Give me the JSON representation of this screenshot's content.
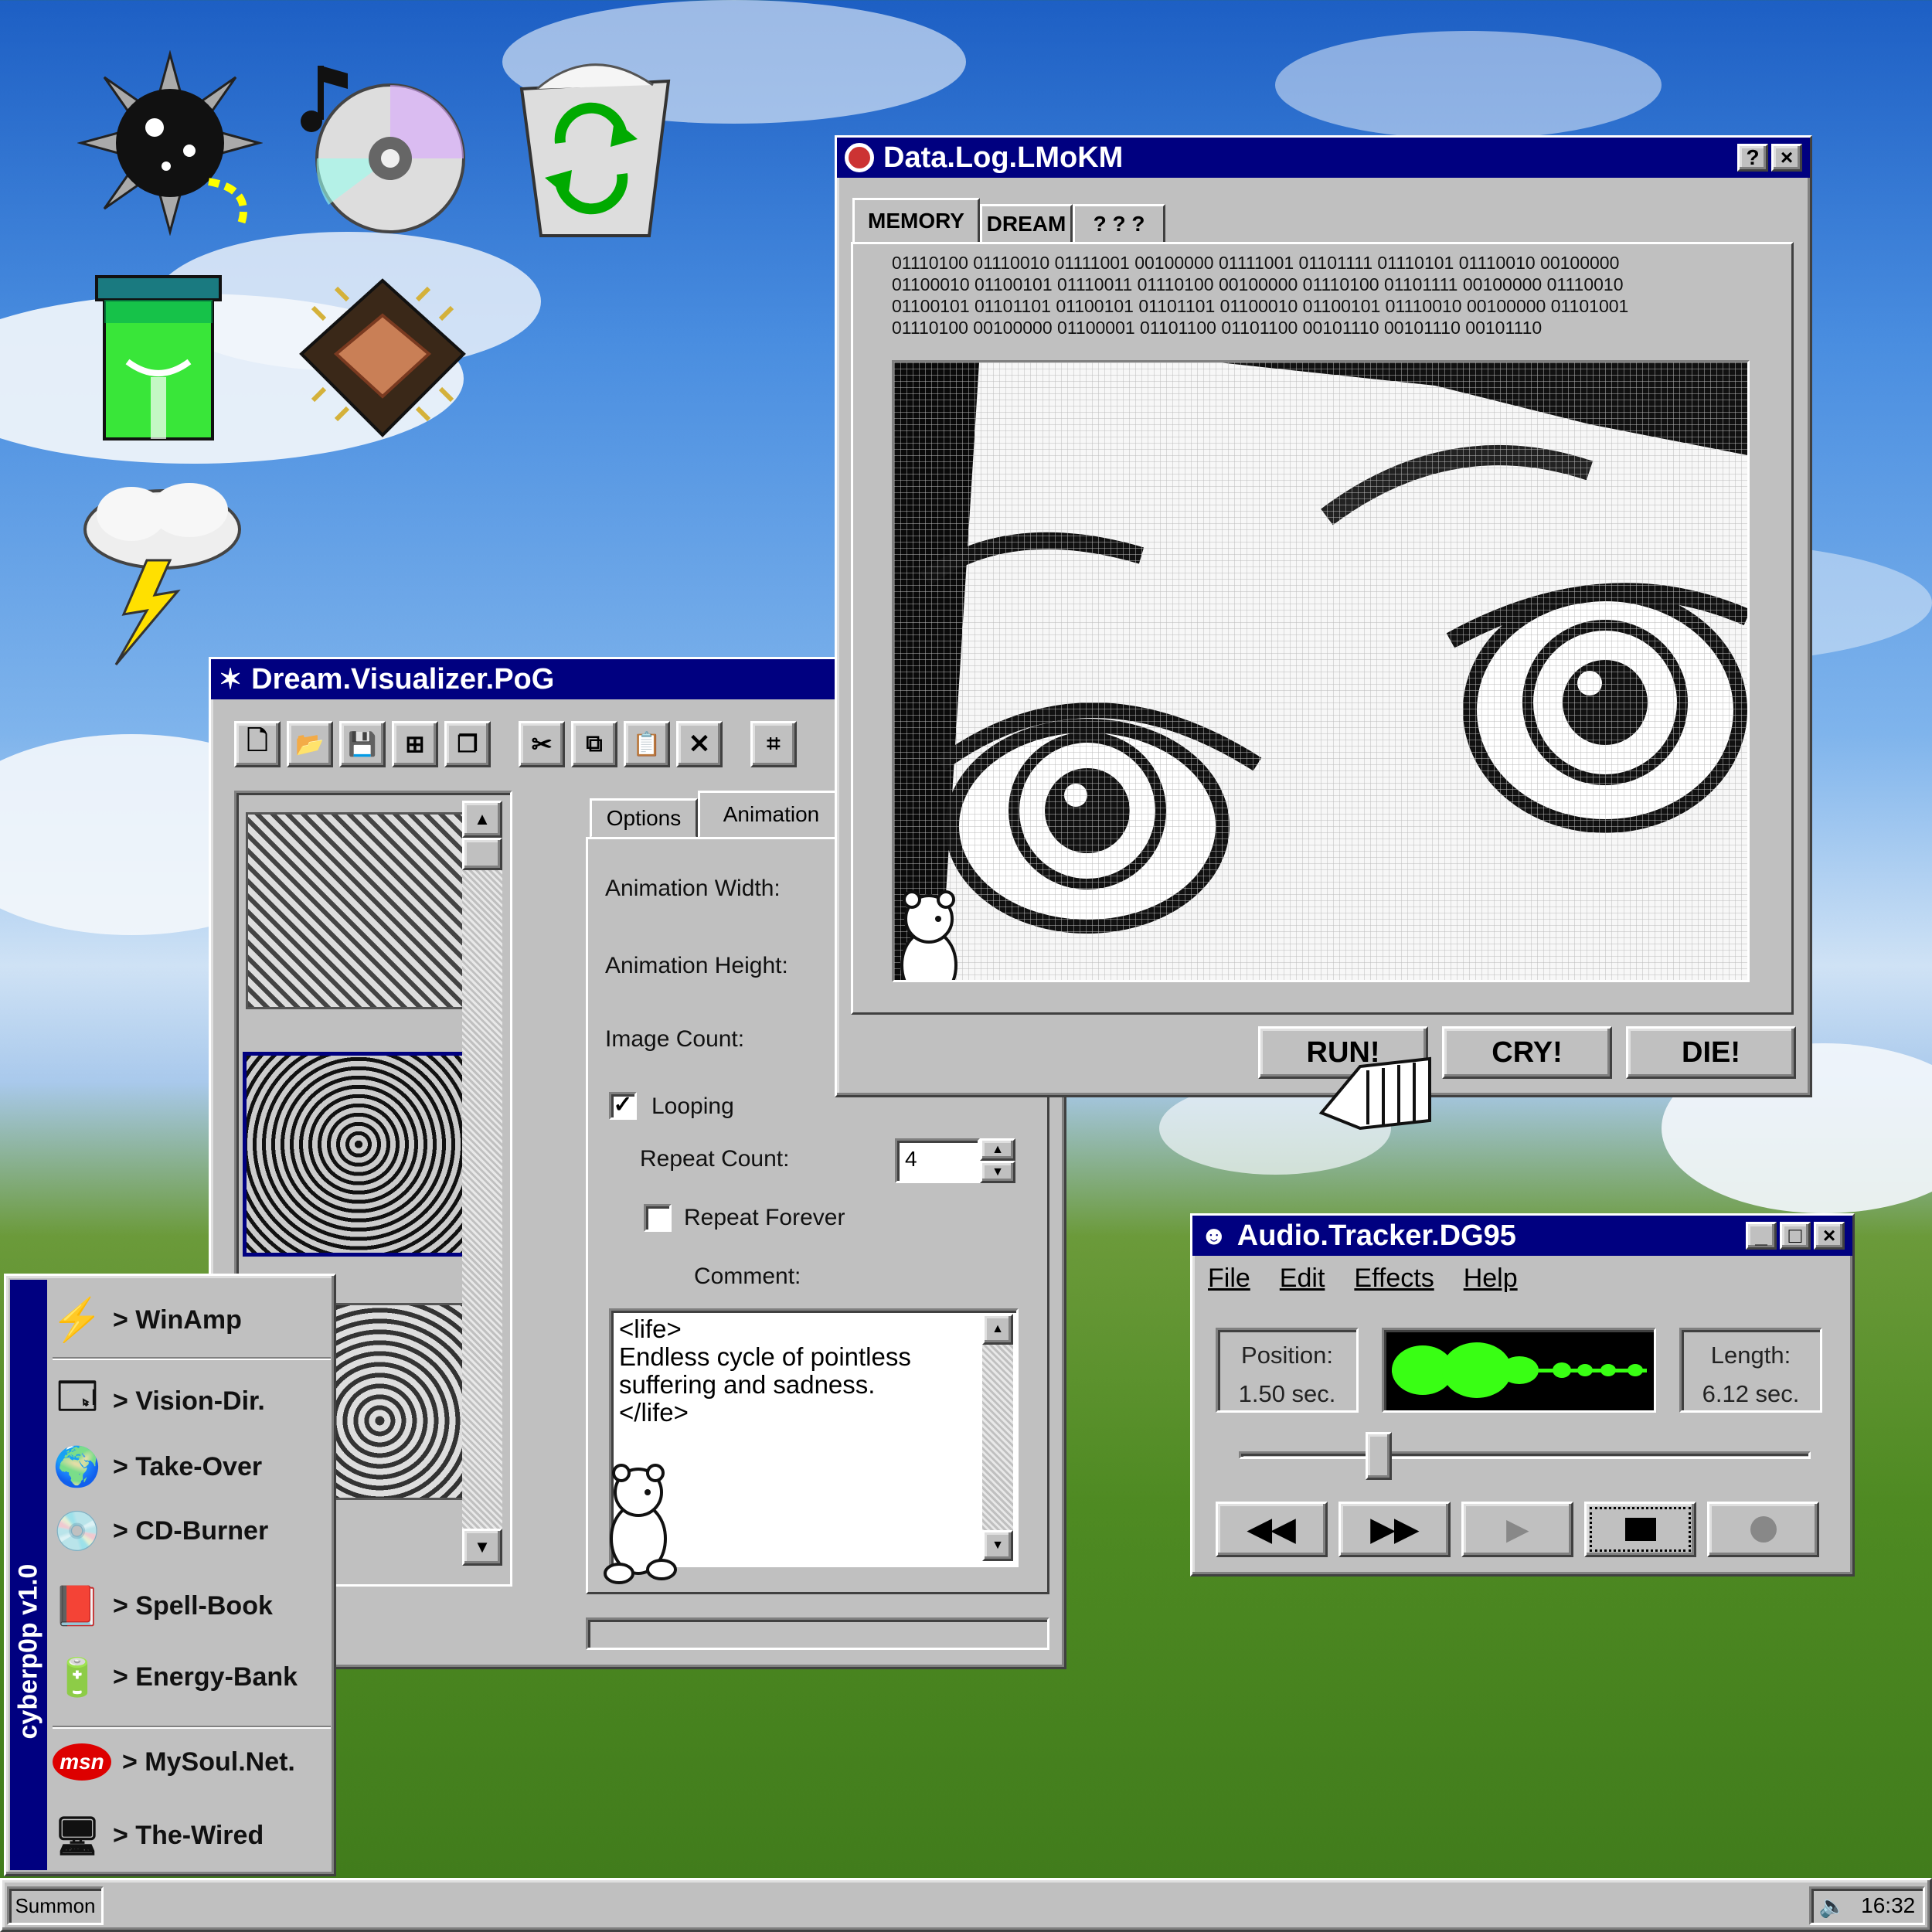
{
  "colors": {
    "titlebar": "#000080",
    "face": "#c0c0c0",
    "wave": "#39ff14"
  },
  "desktop_icons": [
    "spiked-mine-icon",
    "music-cd-icon",
    "recycle-bin-icon",
    "green-jar-icon",
    "microchip-icon",
    "storm-cloud-icon"
  ],
  "data_log": {
    "title": "Data.Log.LMoKM",
    "help": "?",
    "close": "×",
    "tabs": [
      "MEMORY",
      "DREAM",
      "? ? ?"
    ],
    "binary": [
      "01110100 01110010 01111001 00100000 01111001 01101111 01110101 01110010 00100000",
      "01100010 01100101 01110011 01110100 00100000 01110100 01101111 00100000 01110010",
      "01100101 01101101 01100101 01101101 01100010 01100101 01110010 00100000 01101001",
      "01110100 00100000 01100001 01101100 01101100 00101110 00101110 00101110"
    ],
    "buttons": {
      "run": "RUN!",
      "cry": "CRY!",
      "die": "DIE!"
    }
  },
  "visualizer": {
    "title": "Dream.Visualizer.PoG",
    "tabs": {
      "options": "Options",
      "animation": "Animation"
    },
    "labels": {
      "width": "Animation Width:",
      "height": "Animation Height:",
      "count": "Image Count:",
      "looping": "Looping",
      "repeat_count": "Repeat Count:",
      "repeat_forever": "Repeat Forever",
      "comment": "Comment:"
    },
    "repeat_value": "4",
    "looping_checked": true,
    "repeat_forever_checked": false,
    "comment_lines": [
      "<life>",
      "Endless cycle of pointless",
      "suffering and sadness.",
      "</life>"
    ]
  },
  "audio": {
    "title": "Audio.Tracker.DG95",
    "menu": [
      "File",
      "Edit",
      "Effects",
      "Help"
    ],
    "position_label": "Position:",
    "position_value": "1.50 sec.",
    "length_label": "Length:",
    "length_value": "6.12 sec.",
    "progress": 0.245
  },
  "start_menu": {
    "brand": "cyberp0p v1.0",
    "items": [
      "> WinAmp",
      "> Vision-Dir.",
      "> Take-Over",
      "> CD-Burner",
      "> Spell-Book",
      "> Energy-Bank",
      "> MySoul.Net.",
      "> The-Wired"
    ],
    "msn": "msn"
  },
  "taskbar": {
    "start": "Summon",
    "clock": "16:32"
  }
}
